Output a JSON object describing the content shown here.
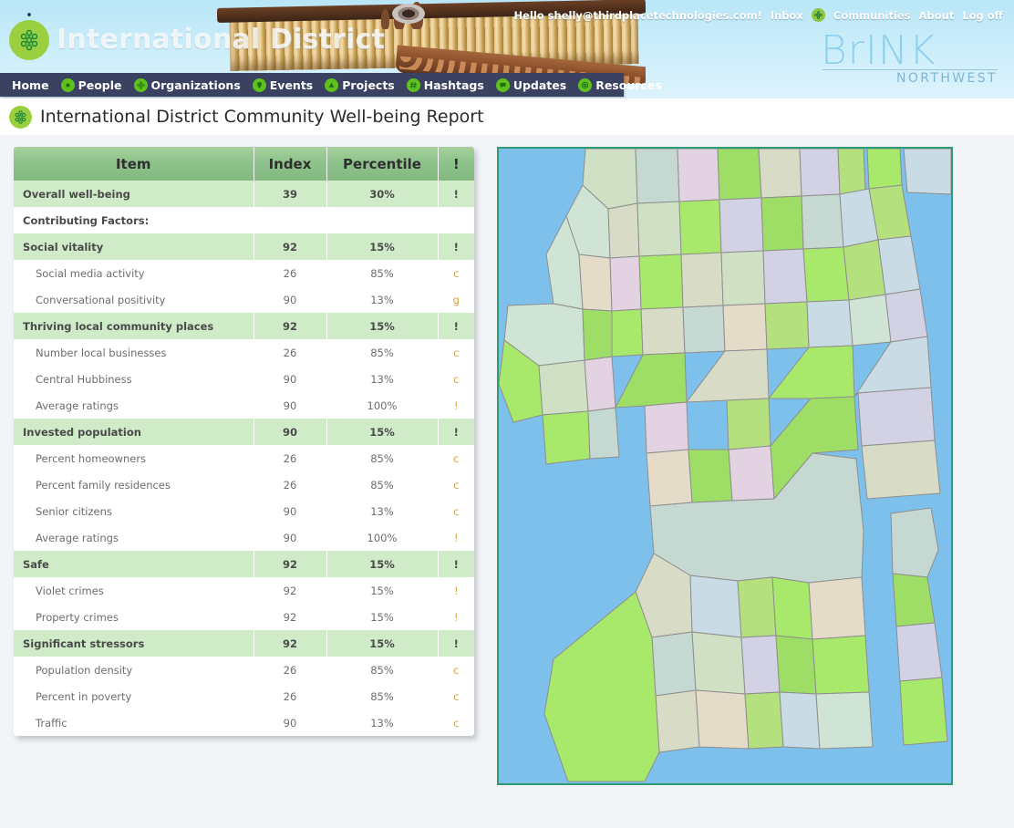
{
  "banner": {
    "site_title": "International District",
    "logo_icon": "lattice-globe-icon"
  },
  "account_bar": {
    "greeting": "Hello shelly@thirdplacetechnologies.com!",
    "inbox": "Inbox",
    "communities_icon": "lattice-globe-icon",
    "communities": "Communities",
    "about": "About",
    "logoff": "Log off"
  },
  "brand": {
    "word": "BrINK",
    "sub": "NORTHWEST"
  },
  "menu": [
    {
      "label": "Home",
      "icon": null
    },
    {
      "label": "People",
      "icon": "person-dot-icon"
    },
    {
      "label": "Organizations",
      "icon": "lattice-globe-icon"
    },
    {
      "label": "Events",
      "icon": "pin-icon"
    },
    {
      "label": "Projects",
      "icon": "triangle-icon"
    },
    {
      "label": "Hashtags",
      "icon": "hash-icon"
    },
    {
      "label": "Updates",
      "icon": "speech-bubble-icon"
    },
    {
      "label": "Resources",
      "icon": "circle-ring-icon"
    }
  ],
  "page": {
    "title": "International District Community Well-being Report",
    "title_icon": "lattice-globe-icon"
  },
  "table": {
    "columns": [
      "Item",
      "Index",
      "Percentile",
      "!"
    ],
    "rows": [
      {
        "type": "head",
        "item": "Overall well-being",
        "index": "39",
        "pct": "30%",
        "flag": "!"
      },
      {
        "type": "label",
        "item": "Contributing Factors:",
        "index": "",
        "pct": "",
        "flag": ""
      },
      {
        "type": "head",
        "item": "Social vitality",
        "index": "92",
        "pct": "15%",
        "flag": "!"
      },
      {
        "type": "sub",
        "item": "Social media activity",
        "index": "26",
        "pct": "85%",
        "flag": "c"
      },
      {
        "type": "sub",
        "item": "Conversational positivity",
        "index": "90",
        "pct": "13%",
        "flag": "g"
      },
      {
        "type": "head",
        "item": "Thriving local community places",
        "index": "92",
        "pct": "15%",
        "flag": "!"
      },
      {
        "type": "sub",
        "item": "Number local businesses",
        "index": "26",
        "pct": "85%",
        "flag": "c"
      },
      {
        "type": "sub",
        "item": "Central Hubbiness",
        "index": "90",
        "pct": "13%",
        "flag": "c"
      },
      {
        "type": "sub",
        "item": "Average ratings",
        "index": "90",
        "pct": "100%",
        "flag": "!"
      },
      {
        "type": "head",
        "item": "Invested population",
        "index": "90",
        "pct": "15%",
        "flag": "!"
      },
      {
        "type": "sub",
        "item": "Percent homeowners",
        "index": "26",
        "pct": "85%",
        "flag": "c"
      },
      {
        "type": "sub",
        "item": "Percent family residences",
        "index": "26",
        "pct": "85%",
        "flag": "c"
      },
      {
        "type": "sub",
        "item": "Senior citizens",
        "index": "90",
        "pct": "13%",
        "flag": "c"
      },
      {
        "type": "sub",
        "item": "Average ratings",
        "index": "90",
        "pct": "100%",
        "flag": "!"
      },
      {
        "type": "head",
        "item": "Safe",
        "index": "92",
        "pct": "15%",
        "flag": "!"
      },
      {
        "type": "sub",
        "item": "Violet crimes",
        "index": "92",
        "pct": "15%",
        "flag": "!"
      },
      {
        "type": "sub",
        "item": "Property crimes",
        "index": "92",
        "pct": "15%",
        "flag": "!"
      },
      {
        "type": "head",
        "item": "Significant stressors",
        "index": "92",
        "pct": "15%",
        "flag": "!"
      },
      {
        "type": "sub",
        "item": "Population density",
        "index": "26",
        "pct": "85%",
        "flag": "c"
      },
      {
        "type": "sub",
        "item": "Percent in poverty",
        "index": "26",
        "pct": "85%",
        "flag": "c"
      },
      {
        "type": "sub",
        "item": "Traffic",
        "index": "90",
        "pct": "13%",
        "flag": "c"
      }
    ]
  },
  "map": {
    "name": "seattle-neighborhood-choropleth",
    "water_color": "#7ec0ec",
    "border_color": "#2e9b74",
    "region_palette": [
      "#b5e07e",
      "#9ede66",
      "#cfe0c5",
      "#d8dcc6",
      "#c6d8d2",
      "#e2d2e2",
      "#d2d2e4",
      "#c9dbe4",
      "#e4dcc8",
      "#cfe4d4"
    ]
  },
  "colors": {
    "menu_bar": "#3b4161",
    "accent_green": "#8dc28a",
    "row_head": "#cfebc8",
    "page_bg": "#f2f4f7",
    "flag_orange": "#d9a441"
  }
}
